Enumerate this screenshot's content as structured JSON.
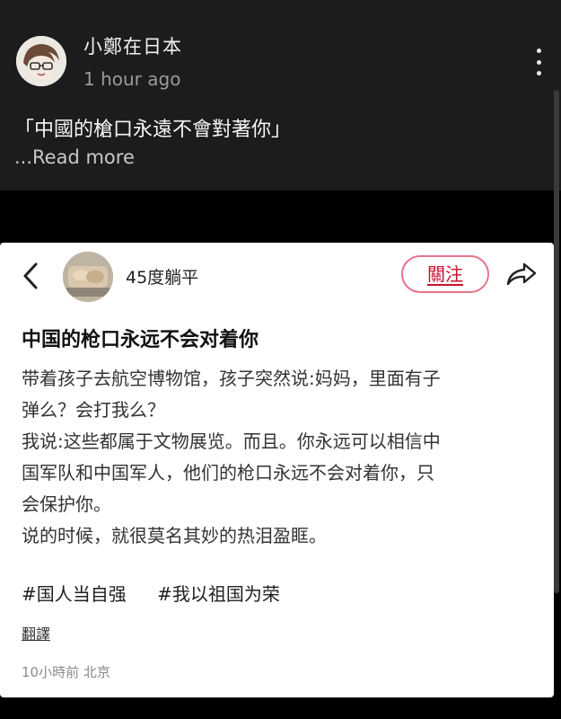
{
  "post": {
    "author": "小鄭在日本",
    "time": "1 hour ago",
    "text": "「中國的槍口永遠不會對著你」",
    "read_more": "...Read more"
  },
  "embedded": {
    "username": "45度躺平",
    "follow_label": "關注",
    "title": "中国的枪口永远不会对着你",
    "body_lines": [
      "带着孩子去航空博物馆，孩子突然说:妈妈，里面有子",
      "弹么？会打我么？",
      "我说:这些都属于文物展览。而且。你永远可以相信中",
      "国军队和中国军人，他们的枪口永远不会对着你，只",
      "会保护你。",
      "说的时候，就很莫名其妙的热泪盈眶。"
    ],
    "tags": [
      "#国人当自强",
      "#我以祖国为荣"
    ],
    "translate_label": "翻譯",
    "meta": "10小時前 北京"
  },
  "icons": {
    "more": "kebab-icon",
    "back": "chevron-left-icon",
    "share": "share-icon"
  },
  "colors": {
    "dark_bg": "#1c1c1e",
    "follow_red": "#c8102e"
  }
}
